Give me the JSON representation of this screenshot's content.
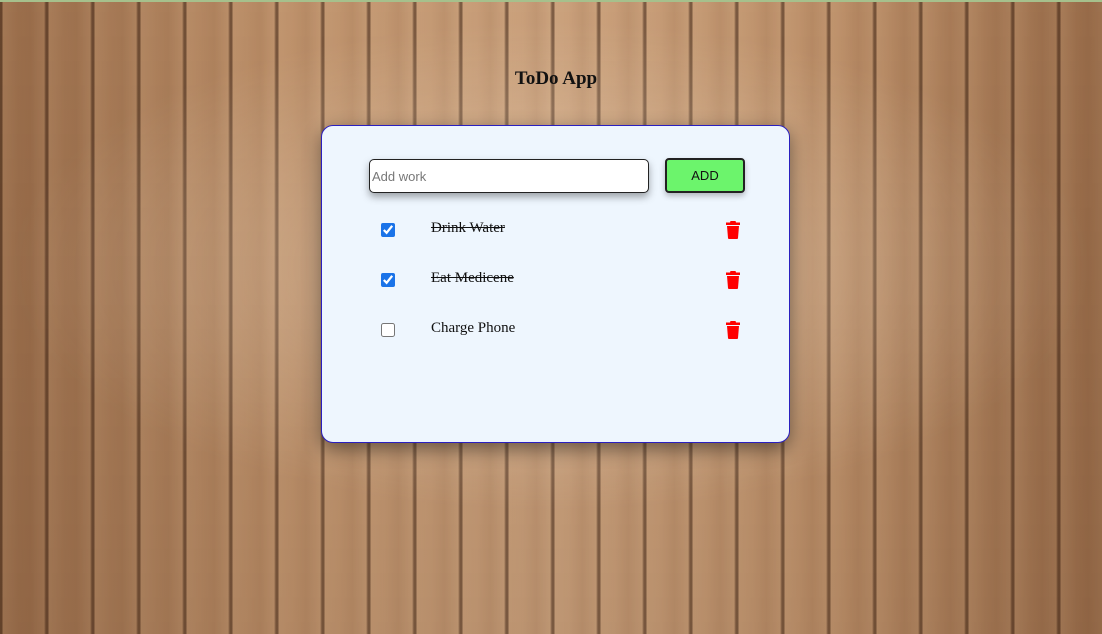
{
  "app": {
    "title": "ToDo App"
  },
  "form": {
    "input_placeholder": "Add work",
    "input_value": "",
    "add_label": "ADD"
  },
  "todos": [
    {
      "text": "Drink Water",
      "completed": true
    },
    {
      "text": "Eat Medicene",
      "completed": true
    },
    {
      "text": "Charge Phone",
      "completed": false
    }
  ],
  "icons": {
    "delete": "trash-icon"
  },
  "colors": {
    "card_background": "#eef6fe",
    "card_border": "#2a1fbf",
    "add_button": "#6cf46c",
    "delete_icon": "#ff0000",
    "checkbox": "#1a73e8"
  }
}
